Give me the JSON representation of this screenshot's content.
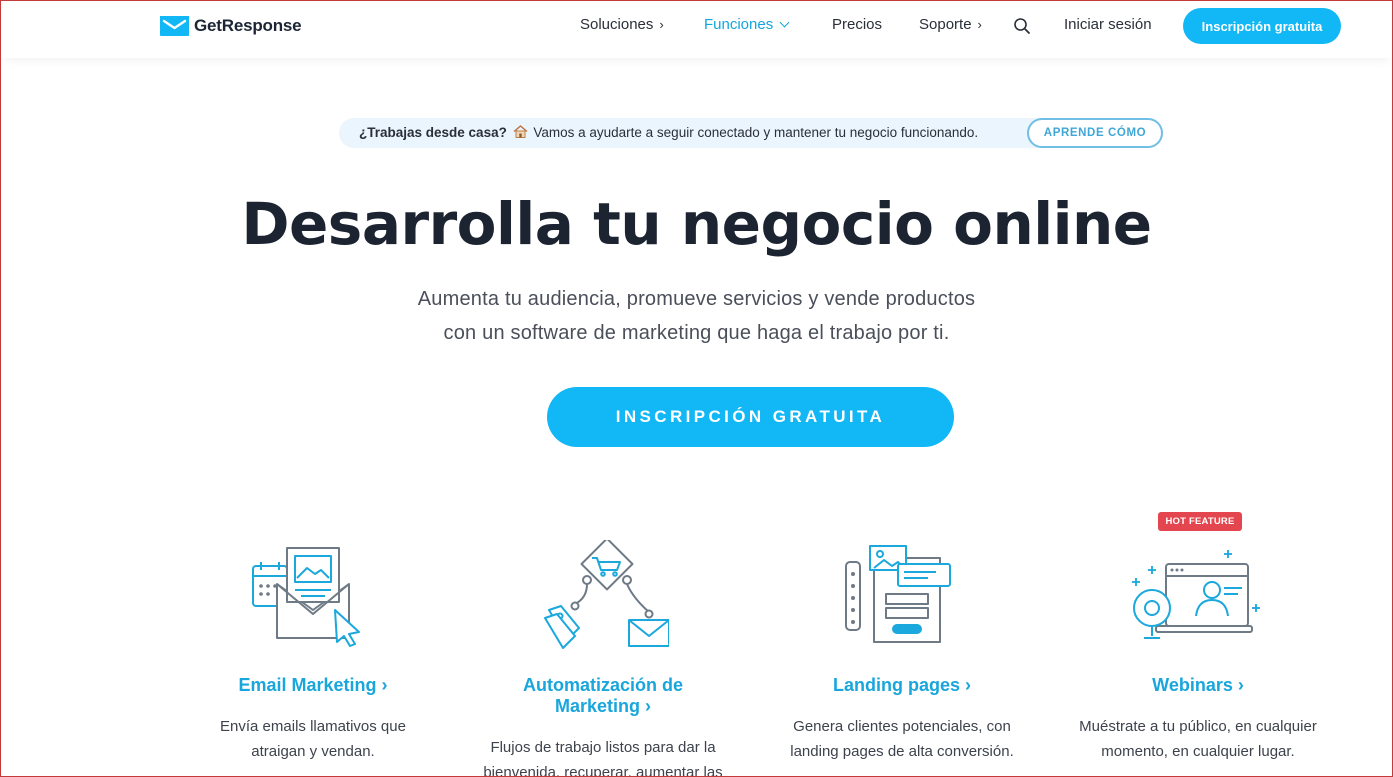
{
  "colors": {
    "brand_blue": "#12b7f5",
    "link_blue": "#19a6dc",
    "hot_badge": "#e4464f",
    "banner_bg": "#eaf5fd"
  },
  "header": {
    "logo_text": "GetResponse",
    "nav": [
      {
        "label": "Soluciones",
        "chevron": "›"
      },
      {
        "label": "Funciones",
        "chevron": "⌄"
      },
      {
        "label": "Precios"
      },
      {
        "label": "Soporte",
        "chevron": "›"
      }
    ],
    "search_icon": "search-icon",
    "login_label": "Iniciar sesión",
    "signup_label": "Inscripción gratuita"
  },
  "banner": {
    "question": "¿Trabajas desde casa?",
    "message": "Vamos a ayudarte a seguir conectado y mantener tu negocio funcionando.",
    "button_label": "APRENDE CÓMO"
  },
  "hero": {
    "title": "Desarrolla tu negocio online",
    "subtitle_line1": "Aumenta tu audiencia, promueve servicios y vende productos",
    "subtitle_line2": "con un software de marketing que haga el trabajo por ti.",
    "cta_label": "INSCRIPCIÓN GRATUITA"
  },
  "features": [
    {
      "title": "Email Marketing ›",
      "desc_line1": "Envía emails llamativos que",
      "desc_line2": "atraigan y vendan.",
      "icon": "email-marketing-icon"
    },
    {
      "title_line1": "Automatización de",
      "title_line2": "Marketing ›",
      "desc_line1": "Flujos de trabajo listos para dar la",
      "desc_line2": "bienvenida, recuperar, aumentar las",
      "icon": "automation-icon"
    },
    {
      "title": "Landing pages ›",
      "desc_line1": "Genera clientes potenciales, con",
      "desc_line2": "landing pages de alta conversión.",
      "icon": "landing-page-icon"
    },
    {
      "title": "Webinars ›",
      "desc_line1": "Muéstrate a tu público, en cualquier",
      "desc_line2": "momento, en cualquier lugar.",
      "icon": "webinar-icon",
      "badge": "HOT FEATURE"
    }
  ]
}
